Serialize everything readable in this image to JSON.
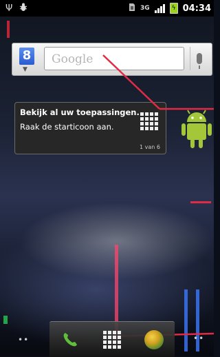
{
  "status_bar": {
    "time": "04:34",
    "network": "3G",
    "icons": [
      "usb-icon",
      "debug-bug-icon",
      "sim-icon",
      "network-3g-icon",
      "signal-icon",
      "battery-charging-icon"
    ]
  },
  "search_widget": {
    "logo": "8",
    "placeholder": "Google",
    "icons": [
      "google-logo-icon",
      "dropdown-caret-icon",
      "microphone-icon"
    ]
  },
  "tooltip": {
    "title": "Bekijk al uw toepassingen.",
    "body": "Raak de starticoon aan.",
    "counter": "1 van 6"
  },
  "dock": {
    "icons": [
      "phone-icon",
      "app-drawer-icon",
      "browser-globe-icon"
    ]
  },
  "home_indicators": {
    "left": "••",
    "right": "••"
  },
  "colors": {
    "callout_red": "#e12b45",
    "battery_green": "#9bd21a",
    "android_green": "#a4c639",
    "phone_green": "#5fbf3a"
  }
}
